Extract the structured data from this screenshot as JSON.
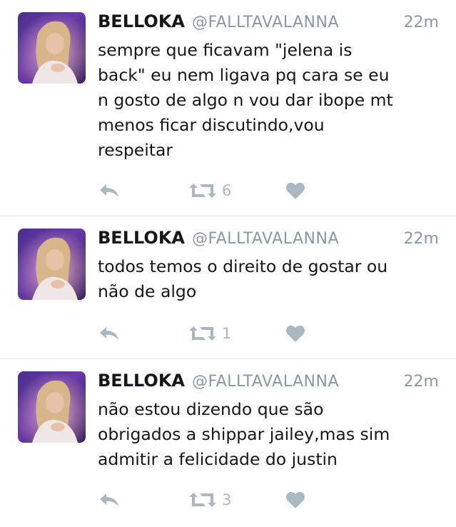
{
  "tweets": [
    {
      "name": "BELLOKA",
      "handle": "@FALLTAVALANNA",
      "time": "22m",
      "text": "sempre que ficavam \"jelena is\nback\" eu nem ligava pq cara se eu\nn gosto de algo n vou dar ibope mt\nmenos ficar discutindo,vou\nrespeitar",
      "retweet_count": "6"
    },
    {
      "name": "BELLOKA",
      "handle": "@FALLTAVALANNA",
      "time": "22m",
      "text": "todos temos o direito de gostar ou\nnão de algo",
      "retweet_count": "1"
    },
    {
      "name": "BELLOKA",
      "handle": "@FALLTAVALANNA",
      "time": "22m",
      "text": "não estou dizendo que são\nobrigados a shippar jailey,mas sim\nadmitir a felicidade do justin",
      "retweet_count": "3"
    }
  ],
  "icons": {
    "reply": "reply-icon",
    "retweet": "retweet-icon",
    "like": "heart-icon"
  },
  "colors": {
    "text": "#14171a",
    "muted": "#8899a6",
    "icon": "#aab8c2",
    "divider": "#e1e8ed"
  }
}
